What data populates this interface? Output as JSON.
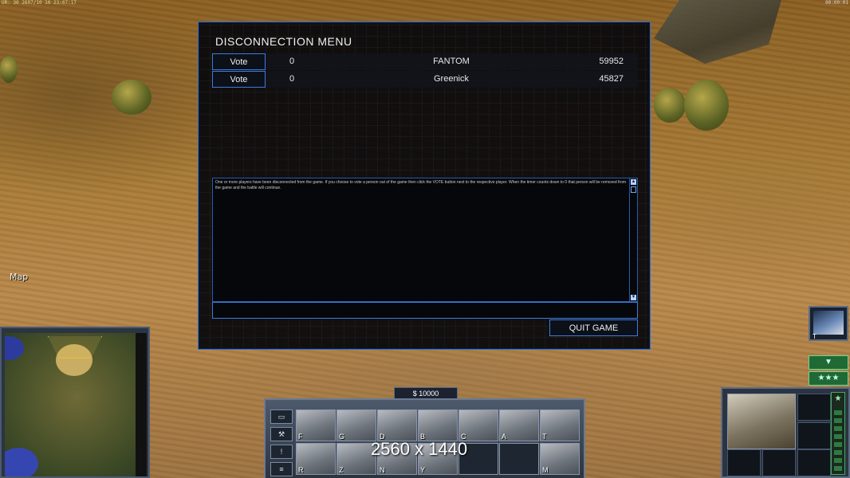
{
  "hud": {
    "top_left": "UR: 30 2607/10 10 23:07:17",
    "top_right": "00:00:01",
    "map_label": "Map",
    "resolution_overlay": "2560 x 1440"
  },
  "dialog": {
    "title": "DISCONNECTION MENU",
    "players": [
      {
        "vote_label": "Vote",
        "votes": "0",
        "name": "FANTOM",
        "ping": "59952"
      },
      {
        "vote_label": "Vote",
        "votes": "0",
        "name": "Greenick",
        "ping": "45827"
      }
    ],
    "message": "One or more players have been disconnected from the game. If you choose to vote a person out of the game then click the VOTE button next to the respective player. When the timer counts down to 0 that person will be removed from the game and the battle will continue.",
    "chat_value": "",
    "quit_label": "QUIT GAME"
  },
  "command_bar": {
    "money": "$ 10000",
    "side_buttons": [
      {
        "icon": "windows-icon",
        "glyph": "▭"
      },
      {
        "icon": "wrench-icon",
        "glyph": "⚒"
      },
      {
        "icon": "alert-icon",
        "glyph": "!"
      },
      {
        "icon": "options-icon",
        "glyph": "≡"
      }
    ],
    "build_keys": [
      "F",
      "G",
      "D",
      "B",
      "C",
      "A",
      "T",
      "R",
      "Z",
      "N",
      "Y",
      "",
      "",
      "M"
    ]
  },
  "right_panel": {
    "general_key": "T",
    "collapse_glyph": "▼",
    "rank_glyph": "★★★",
    "rank_star_glyph": "★"
  },
  "colors": {
    "accent": "#3d7be0",
    "terrain": "#a77a35",
    "rank_green": "#1f6a34"
  }
}
